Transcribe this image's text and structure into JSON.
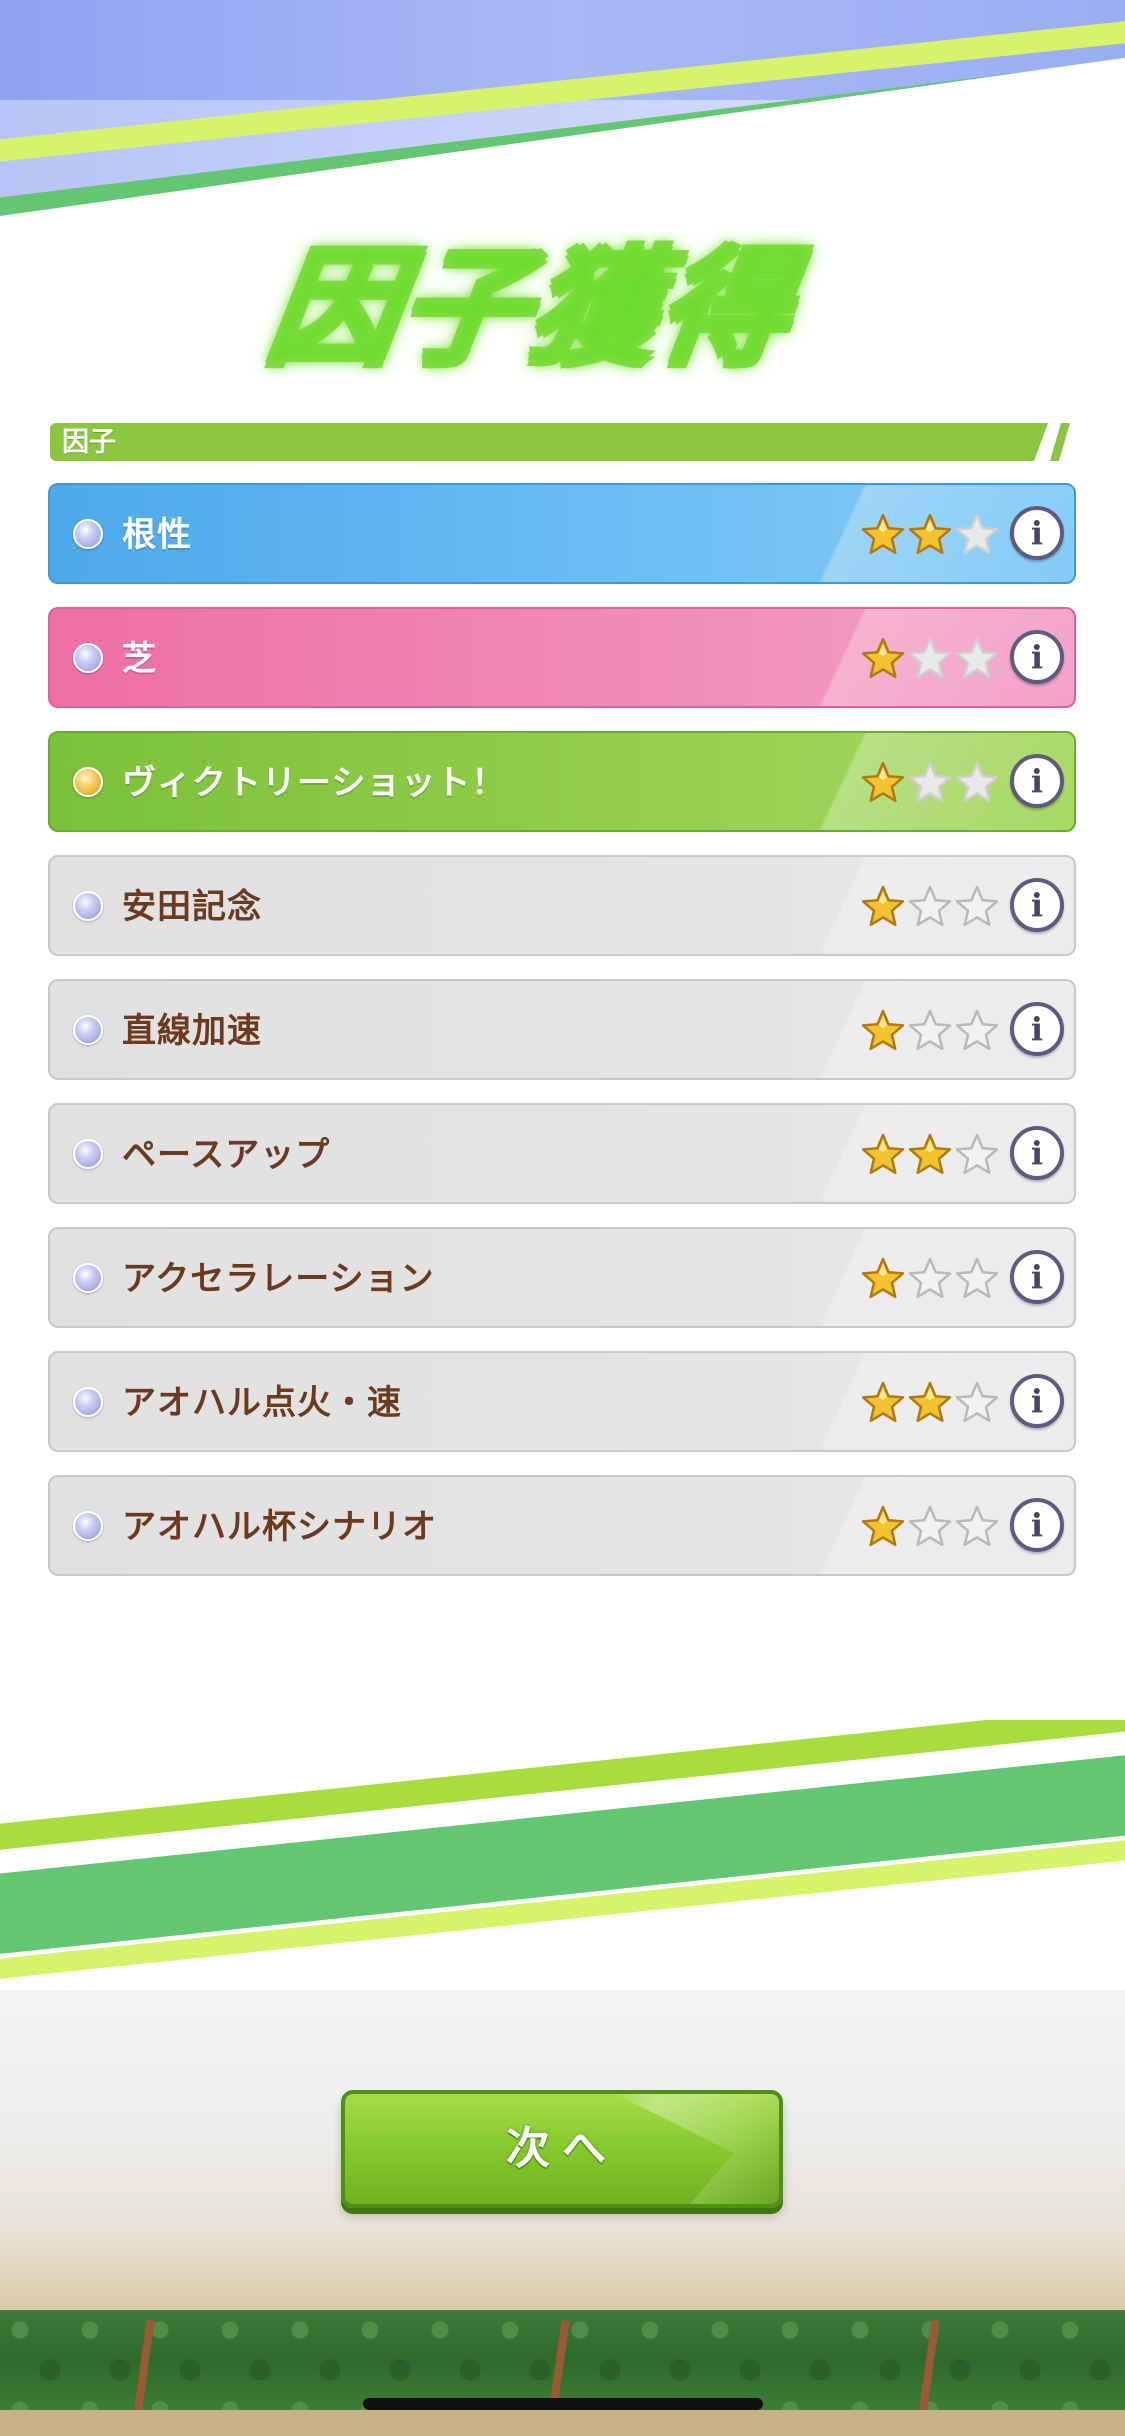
{
  "header": {
    "title": "因子獲得"
  },
  "section": {
    "label": "因子"
  },
  "factors": [
    {
      "name": "根性",
      "color": "blue",
      "stars": 2,
      "max_stars": 3
    },
    {
      "name": "芝",
      "color": "pink",
      "stars": 1,
      "max_stars": 3
    },
    {
      "name": "ヴィクトリーショット！",
      "color": "green",
      "stars": 1,
      "max_stars": 3
    },
    {
      "name": "安田記念",
      "color": "grey",
      "stars": 1,
      "max_stars": 3
    },
    {
      "name": "直線加速",
      "color": "grey",
      "stars": 1,
      "max_stars": 3
    },
    {
      "name": "ペースアップ",
      "color": "grey",
      "stars": 2,
      "max_stars": 3
    },
    {
      "name": "アクセラレーション",
      "color": "grey",
      "stars": 1,
      "max_stars": 3
    },
    {
      "name": "アオハル点火・速",
      "color": "grey",
      "stars": 2,
      "max_stars": 3
    },
    {
      "name": "アオハル杯シナリオ",
      "color": "grey",
      "stars": 1,
      "max_stars": 3
    }
  ],
  "info_icon_glyph": "i",
  "footer": {
    "next_label": "次へ"
  },
  "colors": {
    "accent_green": "#8cc63f",
    "blue_row": "#4ea8ea",
    "pink_row": "#ee6fa5",
    "green_row": "#7cc13a",
    "grey_row": "#e1e1e1",
    "grey_text": "#6b3a1f",
    "star_filled": "#f2c230",
    "star_empty": "#ffffff"
  },
  "icons": {
    "bullet": "gem-bullet-icon",
    "star": "star-icon",
    "info": "info-icon"
  }
}
